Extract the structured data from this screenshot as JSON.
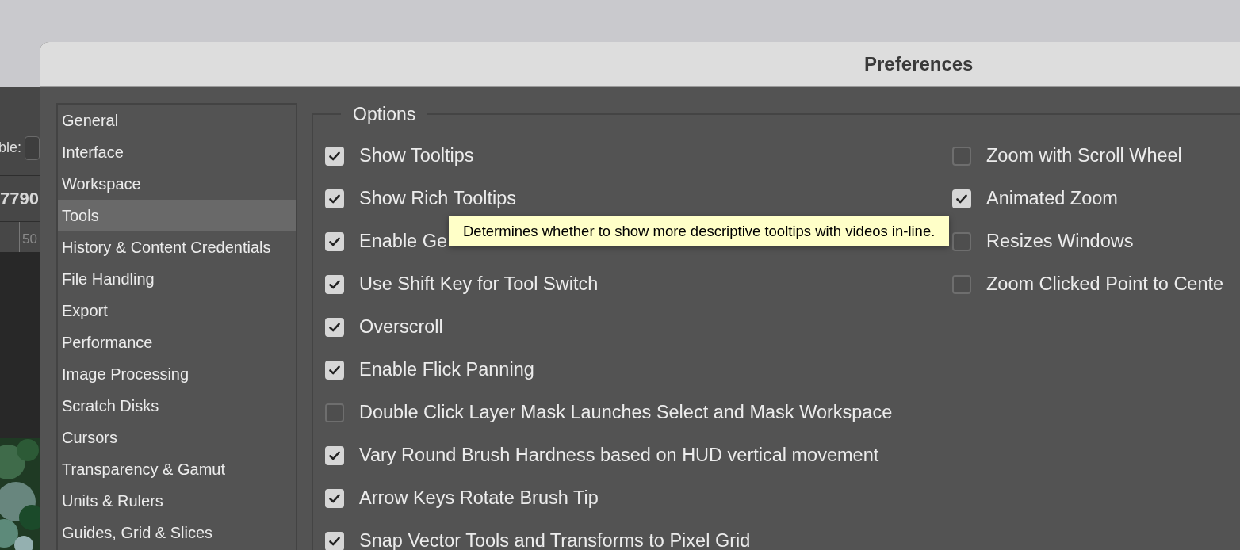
{
  "background_app": {
    "toolbar_label": "ble:",
    "document_size": "7790",
    "ruler_mark": "50"
  },
  "window": {
    "title": "Preferences"
  },
  "sidebar": {
    "items": [
      {
        "label": "General",
        "selected": false
      },
      {
        "label": "Interface",
        "selected": false
      },
      {
        "label": "Workspace",
        "selected": false
      },
      {
        "label": "Tools",
        "selected": true
      },
      {
        "label": "History & Content Credentials",
        "selected": false
      },
      {
        "label": "File Handling",
        "selected": false
      },
      {
        "label": "Export",
        "selected": false
      },
      {
        "label": "Performance",
        "selected": false
      },
      {
        "label": "Image Processing",
        "selected": false
      },
      {
        "label": "Scratch Disks",
        "selected": false
      },
      {
        "label": "Cursors",
        "selected": false
      },
      {
        "label": "Transparency & Gamut",
        "selected": false
      },
      {
        "label": "Units & Rulers",
        "selected": false
      },
      {
        "label": "Guides, Grid & Slices",
        "selected": false
      }
    ]
  },
  "options": {
    "title": "Options",
    "left_column": [
      {
        "label": "Show Tooltips",
        "checked": true
      },
      {
        "label": "Show Rich Tooltips",
        "checked": true
      },
      {
        "label": "Enable Ge",
        "checked": true
      },
      {
        "label": "Use Shift Key for Tool Switch",
        "checked": true
      },
      {
        "label": "Overscroll",
        "checked": true
      },
      {
        "label": "Enable Flick Panning",
        "checked": true
      },
      {
        "label": "Double Click Layer Mask Launches Select and Mask Workspace",
        "checked": false
      },
      {
        "label": "Vary Round Brush Hardness based on HUD vertical movement",
        "checked": true
      },
      {
        "label": "Arrow Keys Rotate Brush Tip",
        "checked": true
      },
      {
        "label": "Snap Vector Tools and Transforms to Pixel Grid",
        "checked": true
      }
    ],
    "right_column": [
      {
        "label": "Zoom with Scroll Wheel",
        "checked": false
      },
      {
        "label": "Animated Zoom",
        "checked": true
      },
      {
        "label": "Resizes Windows",
        "checked": false
      },
      {
        "label": "Zoom Clicked Point to Cente",
        "checked": false
      }
    ]
  },
  "tooltip": {
    "text": "Determines whether to show more descriptive tooltips with videos in-line."
  }
}
